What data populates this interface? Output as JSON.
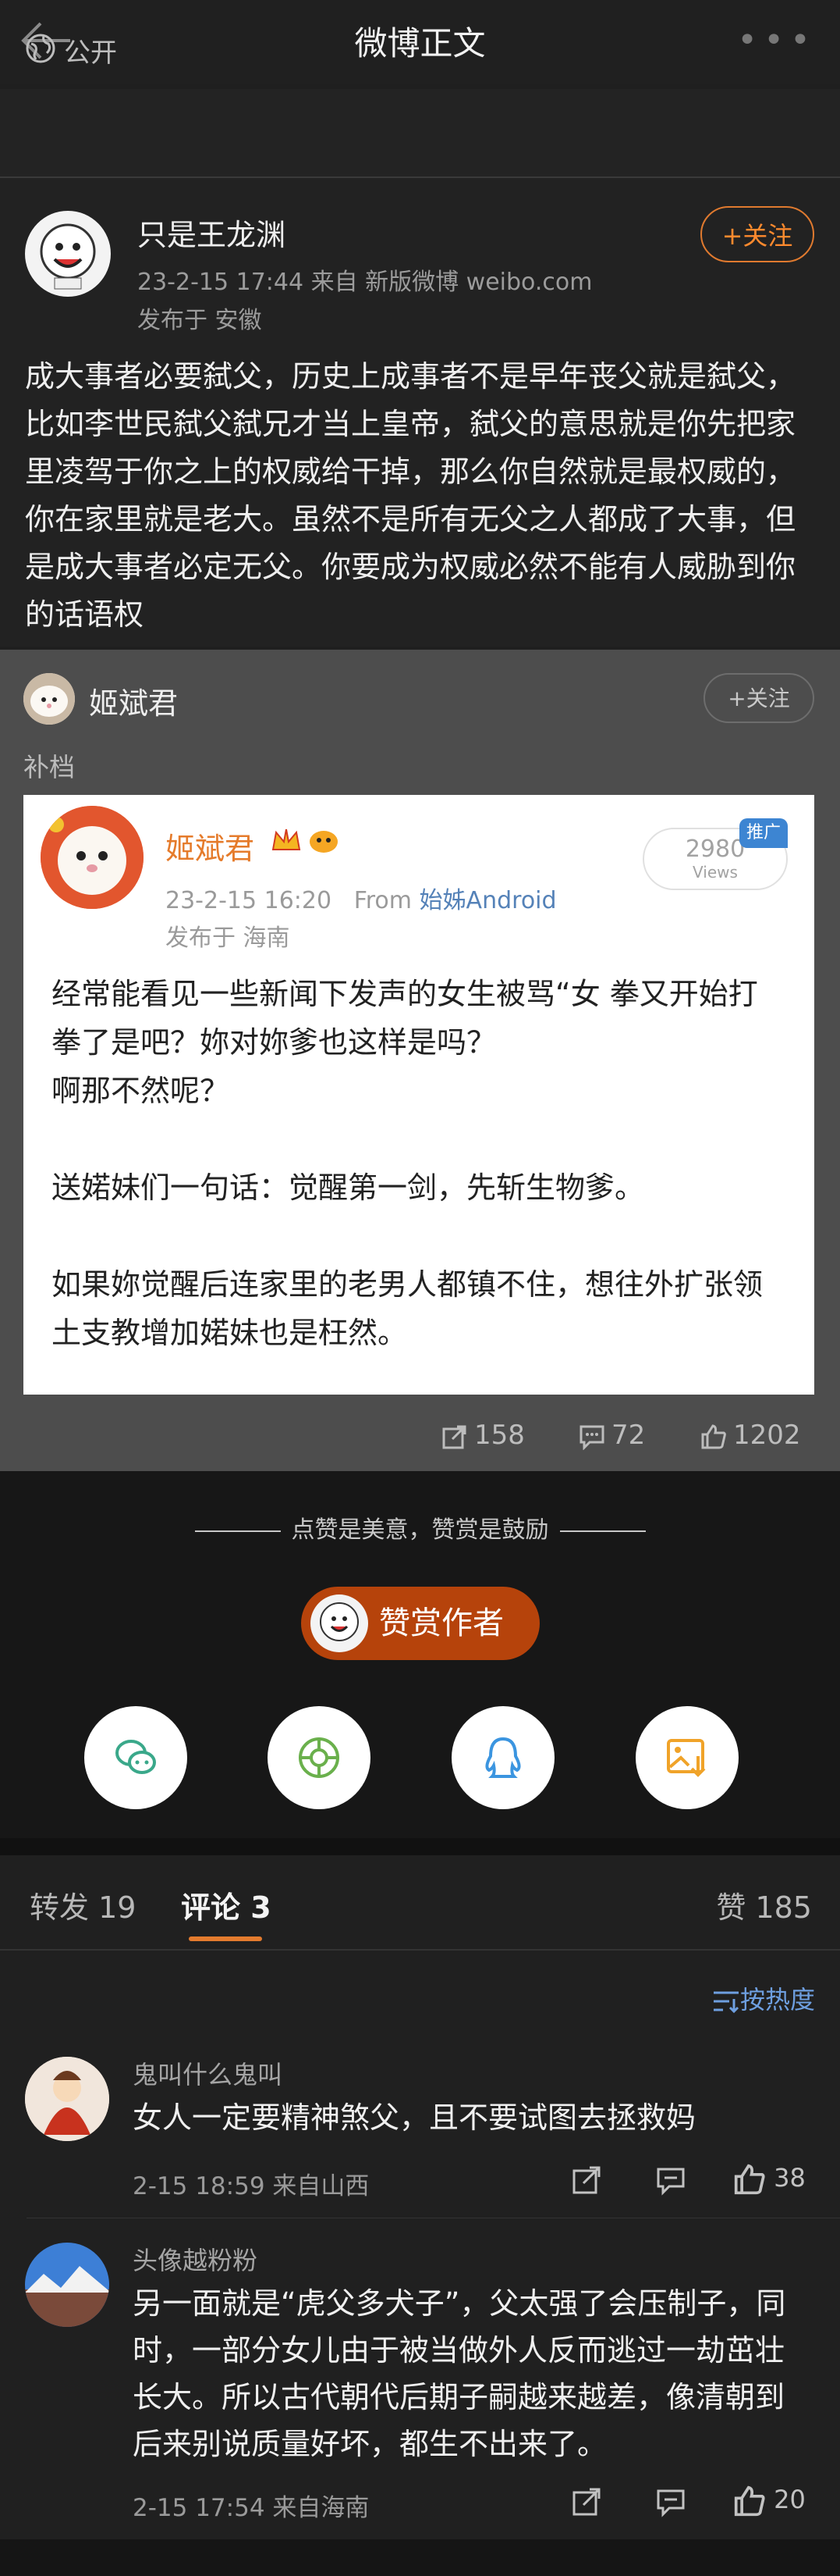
{
  "header": {
    "title": "微博正文",
    "back_icon": "arrow-left-icon",
    "more_icon": "more-dots-icon"
  },
  "visibility": {
    "label": "公开",
    "icon": "globe-icon"
  },
  "post": {
    "author": "只是王龙渊",
    "meta": "23-2-15 17:44   来自 新版微博 weibo.com",
    "location": "发布于 安徽",
    "follow_label": "+关注",
    "text": "成大事者必要弑父，历史上成事者不是早年丧父就是弑父，比如李世民弑父弑兄才当上皇帝，弑父的意思就是你先把家里凌驾于你之上的权威给干掉，那么你自然就是最权威的，你在家里就是老大。虽然不是所有无父之人都成了大事，但是成大事者必定无父。你要成为权威必然不能有人威胁到你的话语权"
  },
  "repost": {
    "author": "姬斌君",
    "follow_label": "+关注",
    "note": "补档",
    "card": {
      "author": "姬斌君",
      "time": "23-2-15 16:20",
      "from_prefix": "From",
      "source": "始姊Android",
      "location": "发布于 海南",
      "views_count": "2980",
      "views_label": "Views",
      "promo_label": "推广",
      "text": "经常能看见一些新闻下发声的女生被骂“女 拳又开始打拳了是吧？妳对妳爹也这样是吗？\n啊那不然呢？\n\n送婼妹们一句话：觉醒第一剑，先斩生物爹。\n\n如果妳觉醒后连家里的老男人都镇不住，想往外扩张领土支教增加婼妹也是枉然。"
    },
    "stats": {
      "reposts": "158",
      "comments": "72",
      "likes": "1202"
    }
  },
  "reward": {
    "tagline": "点赞是美意，赞赏是鼓励",
    "button_label": "赞赏作者",
    "share_icons": [
      "wechat-icon",
      "moments-icon",
      "qq-icon",
      "save-image-icon"
    ]
  },
  "tabs": {
    "repost": "转发 19",
    "comment": "评论 3",
    "like": "赞 185",
    "sort_label": "按热度"
  },
  "comments": [
    {
      "name": "鬼叫什么鬼叫",
      "text": "女人一定要精神煞父，且不要试图去拯救妈",
      "meta": "2-15 18:59  来自山西",
      "likes": "38"
    },
    {
      "name": "头像越粉粉",
      "text": "另一面就是“虎父多犬子”，父太强了会压制子，同时，一部分女儿由于被当做外人反而逃过一劫茁壮长大。所以古代朝代后期子嗣越来越差，像清朝到后来别说质量好坏，都生不出来了。",
      "meta": "2-15 17:54  来自海南",
      "likes": "20"
    }
  ],
  "colors": {
    "accent": "#e07a2f",
    "link": "#6e9fe0",
    "bg": "#1f1f1f"
  }
}
